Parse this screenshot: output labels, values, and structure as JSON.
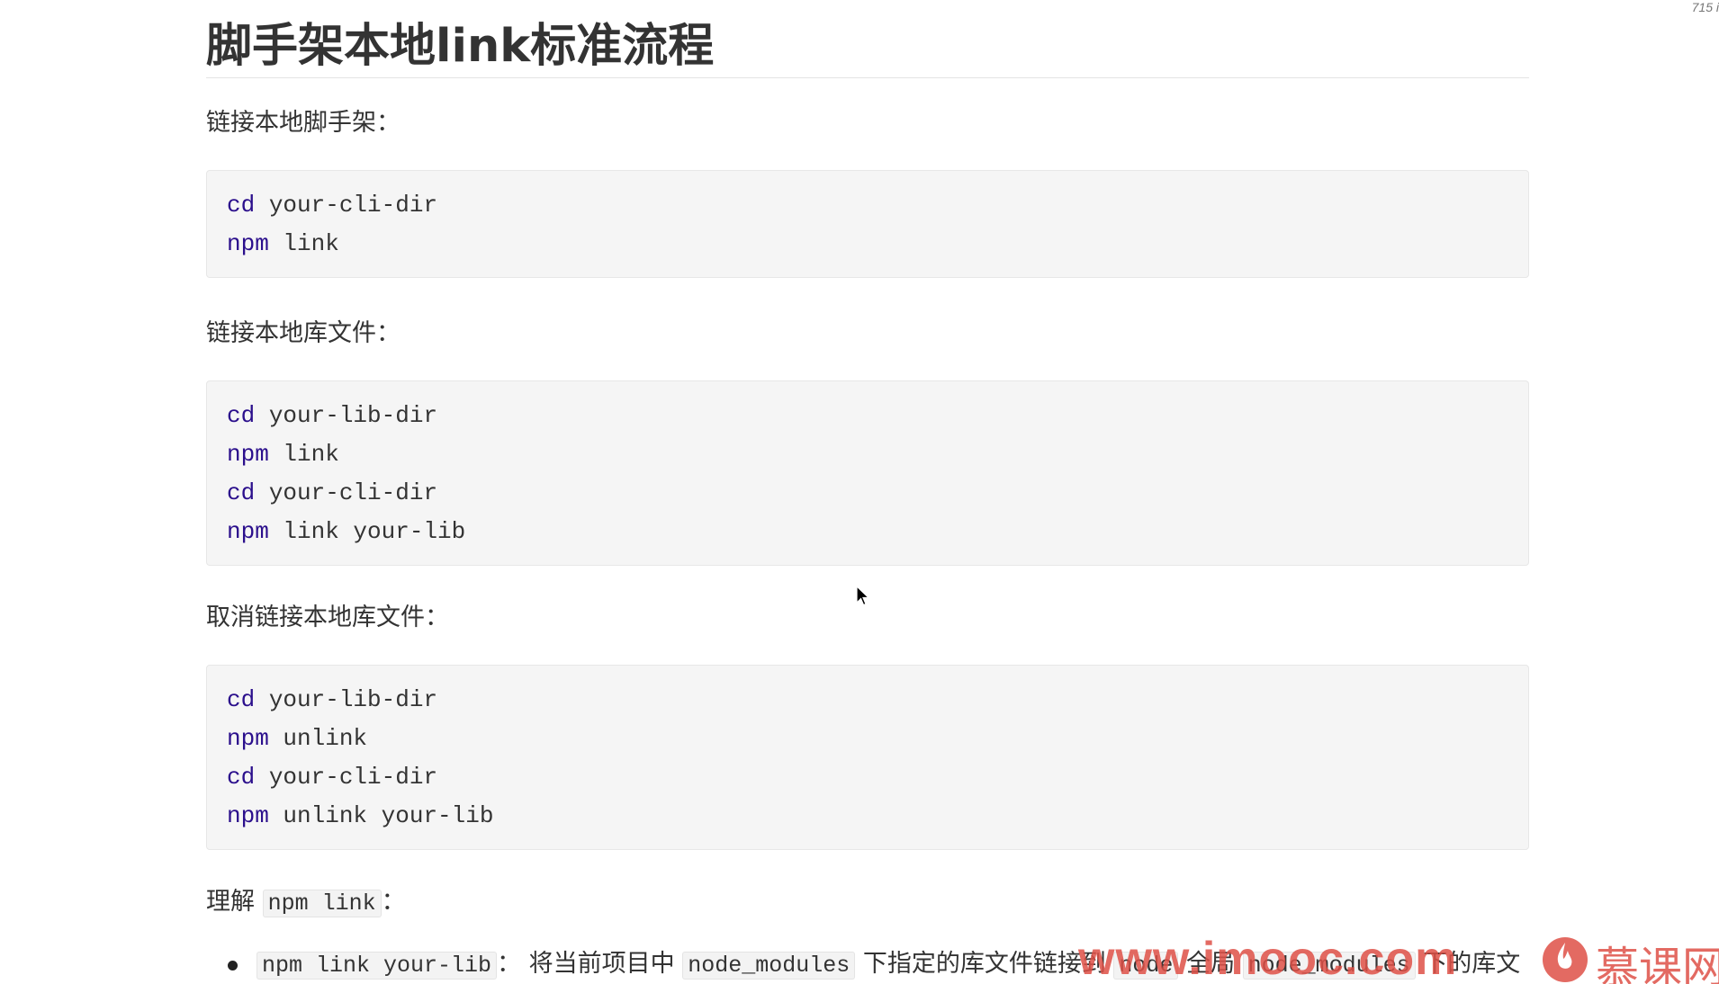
{
  "corner": {
    "text": "715 i"
  },
  "doc": {
    "title": "脚手架本地link标准流程",
    "sections": [
      {
        "heading": "链接本地脚手架：",
        "code": [
          {
            "cmd": "cd",
            "args": " your-cli-dir"
          },
          {
            "cmd": "npm",
            "args": " link"
          }
        ]
      },
      {
        "heading": "链接本地库文件：",
        "code": [
          {
            "cmd": "cd",
            "args": " your-lib-dir"
          },
          {
            "cmd": "npm",
            "args": " link"
          },
          {
            "cmd": "cd",
            "args": " your-cli-dir"
          },
          {
            "cmd": "npm",
            "args": " link your-lib"
          }
        ]
      },
      {
        "heading": "取消链接本地库文件：",
        "code": [
          {
            "cmd": "cd",
            "args": " your-lib-dir"
          },
          {
            "cmd": "npm",
            "args": " unlink"
          },
          {
            "cmd": "cd",
            "args": " your-cli-dir"
          },
          {
            "cmd": "npm",
            "args": " unlink your-lib"
          }
        ]
      }
    ],
    "understand": {
      "prefix": "理解 ",
      "code": "npm link",
      "suffix": "："
    },
    "bullets": [
      {
        "code1": "npm link your-lib",
        "text1": "： 将当前项目中 ",
        "code2": "node_modules",
        "text2": " 下指定的库文件链接到 ",
        "code3": "node",
        "text3": " 全局 ",
        "code4": "node_modules",
        "text4": " 下的库文件"
      }
    ]
  },
  "watermark": {
    "url": "www.imooc.com",
    "brand": "慕课网",
    "color": "#de5046"
  }
}
